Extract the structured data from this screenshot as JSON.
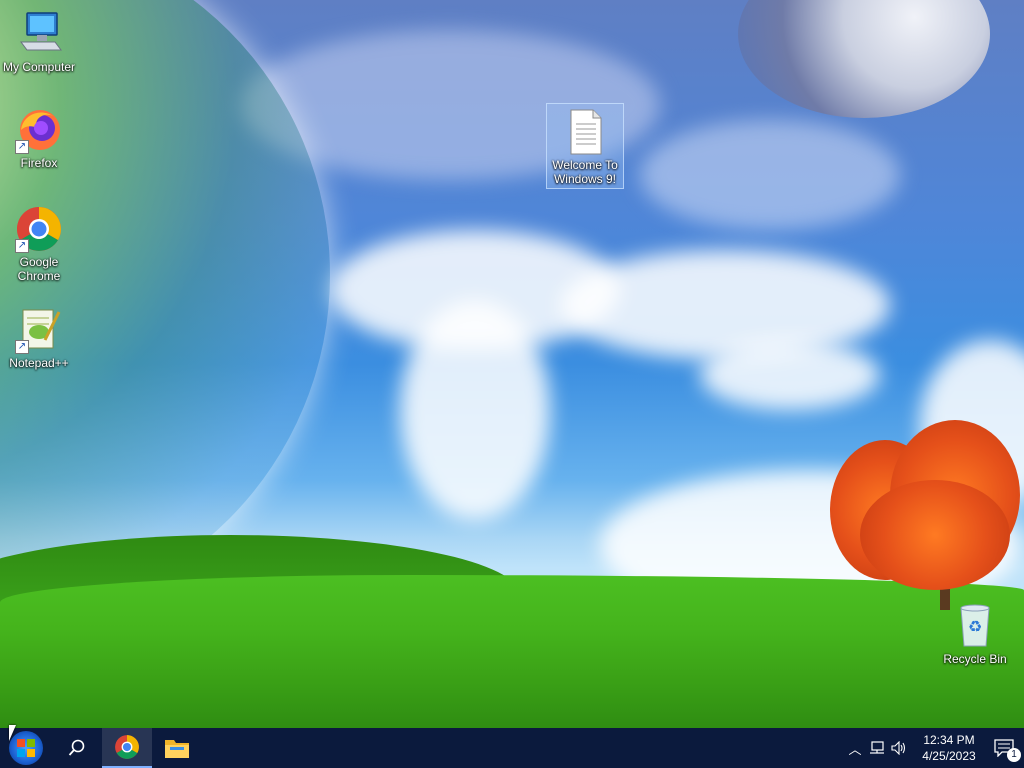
{
  "desktop": {
    "icons": [
      {
        "label": "My Computer",
        "icon": "computer-icon"
      },
      {
        "label": "Firefox",
        "icon": "firefox-icon",
        "shortcut": true
      },
      {
        "label": "Google Chrome",
        "icon": "chrome-icon",
        "shortcut": true
      },
      {
        "label": "Notepad++",
        "icon": "notepadpp-icon",
        "shortcut": true
      },
      {
        "label": "Welcome To Windows 9!",
        "icon": "text-document-icon",
        "selected": true
      },
      {
        "label": "Recycle Bin",
        "icon": "recycle-bin-icon"
      }
    ]
  },
  "taskbar": {
    "start_icon": "windows-start-icon",
    "search_icon": "search-icon",
    "pinned": [
      {
        "name": "chrome",
        "icon": "chrome-icon",
        "active": true
      },
      {
        "name": "file-explorer",
        "icon": "folder-icon",
        "active": false
      }
    ],
    "tray": {
      "icons": [
        "chevron-up-icon",
        "network-icon",
        "volume-icon"
      ],
      "time": "12:34 PM",
      "date": "4/25/2023",
      "notification_count": "1"
    },
    "accent_color": "#0b1a3d"
  }
}
